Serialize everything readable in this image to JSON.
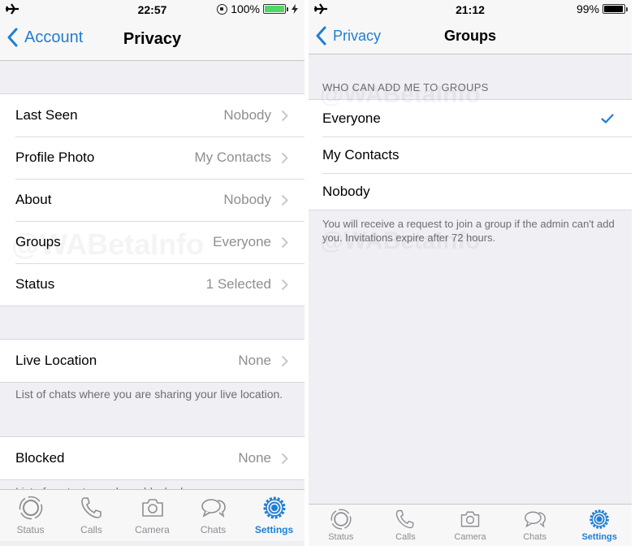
{
  "colors": {
    "accent": "#1f7ed4",
    "battery_charging": "#4cd964",
    "battery": "#000000",
    "secondary_text": "#8e8e93"
  },
  "left": {
    "status": {
      "time": "22:57",
      "battery_pct": "100%",
      "icons": [
        "airplane-icon",
        "rotation-lock-icon",
        "battery-icon",
        "charging-bolt-icon"
      ]
    },
    "nav": {
      "back_label": "Account",
      "title": "Privacy"
    },
    "group1": [
      {
        "label": "Last Seen",
        "value": "Nobody"
      },
      {
        "label": "Profile Photo",
        "value": "My Contacts"
      },
      {
        "label": "About",
        "value": "Nobody"
      },
      {
        "label": "Groups",
        "value": "Everyone"
      },
      {
        "label": "Status",
        "value": "1 Selected"
      }
    ],
    "live_location": {
      "label": "Live Location",
      "value": "None",
      "footer": "List of chats where you are sharing your live location."
    },
    "blocked": {
      "label": "Blocked",
      "value": "None",
      "footer": "List of contacts you have blocked."
    },
    "watermark": "@WABetaInfo"
  },
  "right": {
    "status": {
      "time": "21:12",
      "battery_pct": "99%",
      "icons": [
        "airplane-icon",
        "battery-icon"
      ]
    },
    "nav": {
      "back_label": "Privacy",
      "title": "Groups"
    },
    "section_header": "WHO CAN ADD ME TO GROUPS",
    "options": [
      {
        "label": "Everyone",
        "selected": true
      },
      {
        "label": "My Contacts",
        "selected": false
      },
      {
        "label": "Nobody",
        "selected": false
      }
    ],
    "footer": "You will receive a request to join a group if the admin can't add you. Invitations expire after 72 hours.",
    "watermark": "@WABetaInfo"
  },
  "tabbar": {
    "tabs": [
      {
        "label": "Status",
        "icon": "status-icon"
      },
      {
        "label": "Calls",
        "icon": "phone-icon"
      },
      {
        "label": "Camera",
        "icon": "camera-icon"
      },
      {
        "label": "Chats",
        "icon": "chat-bubbles-icon"
      },
      {
        "label": "Settings",
        "icon": "gear-icon"
      }
    ],
    "active": "Settings"
  }
}
